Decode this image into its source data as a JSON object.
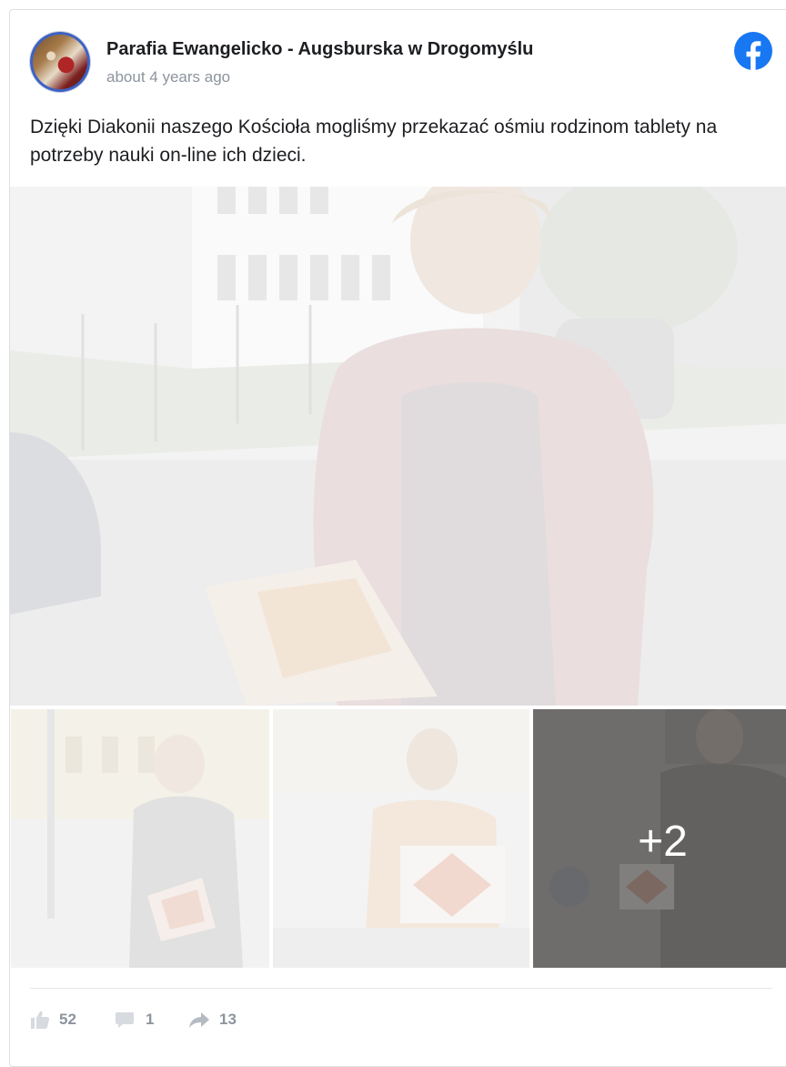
{
  "post": {
    "author": "Parafia Ewangelicko - Augsburska w Drogomyślu",
    "timestamp": "about 4 years ago",
    "text": "Dzięki Diakonii naszego Kościoła mogliśmy przekazać ośmiu rodzinom tablety na potrzeby nauki on-line ich dzieci.",
    "source_icon": "facebook-icon",
    "brand_color": "#1877f2"
  },
  "photos": {
    "more_label": "+2"
  },
  "stats": {
    "likes": "52",
    "comments": "1",
    "shares": "13",
    "icons": [
      "like-icon",
      "comment-icon",
      "share-icon"
    ]
  }
}
